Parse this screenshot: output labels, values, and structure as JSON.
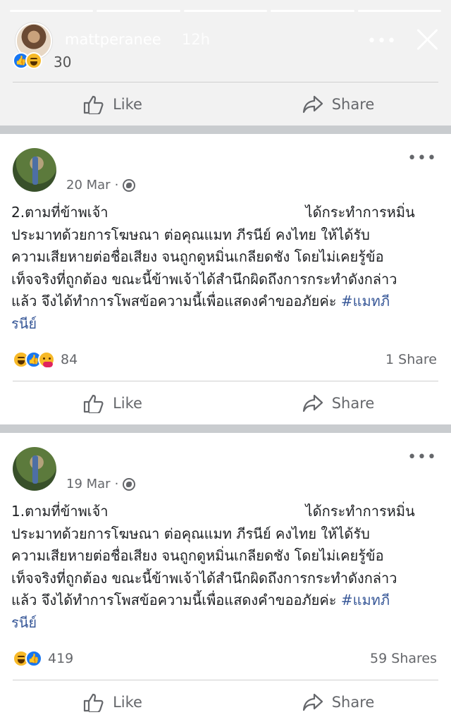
{
  "story": {
    "username": "mattperanee",
    "time": "12h",
    "more_icon": "more-horizontal-icon",
    "close_icon": "close-icon",
    "reaction_count": "30",
    "reactions": [
      "like",
      "haha"
    ]
  },
  "actions": {
    "like_label": "Like",
    "share_label": "Share"
  },
  "posts": [
    {
      "date": "20 Mar",
      "separator": "·",
      "lines": [
        "2.ตามที่ข้าพเจ้า",
        "ได้กระทำการหมิ่น",
        "ประมาทด้วยการโฆษณา ต่อคุณแมท ภีรนีย์ คงไทย ให้ได้รับ",
        "ความเสียหายต่อชื่อเสียง จนถูกดูหมิ่นเกลียดชัง โดยไม่เคยรู้ข้อ",
        "เท็จจริงที่ถูกต้อง ขณะนี้ข้าพเจ้าได้สำนึกผิดถึงการกระทำดังกล่าว",
        "แล้ว จึงได้ทำการโพสข้อความนี้เพื่อแสดงคำขออภัยค่ะ",
        "#แมทภี",
        "รนีย์"
      ],
      "reaction_count": "84",
      "shares": "1 Share"
    },
    {
      "date": "19 Mar",
      "separator": "·",
      "lines": [
        "1.ตามที่ข้าพเจ้า",
        "ได้กระทำการหมิ่น",
        "ประมาทด้วยการโฆษณา ต่อคุณแมท ภีรนีย์ คงไทย ให้ได้รับ",
        "ความเสียหายต่อชื่อเสียง จนถูกดูหมิ่นเกลียดชัง โดยไม่เคยรู้ข้อ",
        "เท็จจริงที่ถูกต้อง ขณะนี้ข้าพเจ้าได้สำนึกผิดถึงการกระทำดังกล่าว",
        "แล้ว จึงได้ทำการโพสข้อความนี้เพื่อแสดงคำขออภัยค่ะ",
        "#แมทภี",
        "รนีย์"
      ],
      "reaction_count": "419",
      "shares": "59 Shares"
    }
  ],
  "colors": {
    "hashtag": "#385898",
    "like_blue": "#1877f2",
    "muted": "#65676b",
    "separator": "#c9cccf"
  }
}
